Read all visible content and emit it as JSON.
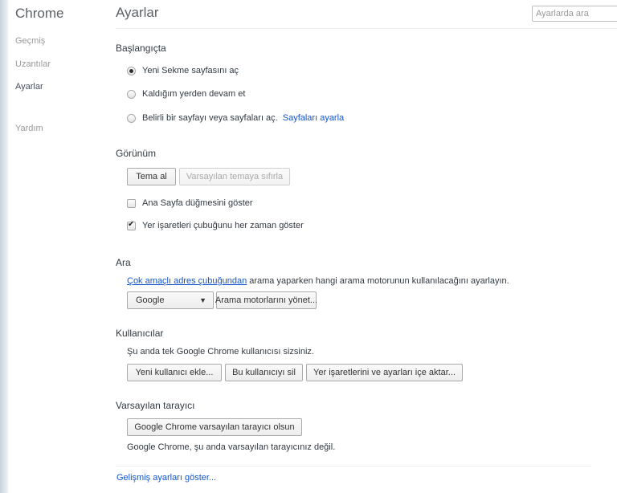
{
  "sidebar": {
    "brand": "Chrome",
    "items": [
      {
        "label": "Geçmiş"
      },
      {
        "label": "Uzantılar"
      },
      {
        "label": "Ayarlar"
      },
      {
        "label": "Yardım"
      }
    ]
  },
  "header": {
    "title": "Ayarlar",
    "search_placeholder": "Ayarlarda ara"
  },
  "startup": {
    "title": "Başlangıçta",
    "options": [
      {
        "label": "Yeni Sekme sayfasını aç",
        "checked": true
      },
      {
        "label": "Kaldığım yerden devam et",
        "checked": false
      },
      {
        "label": "Belirli bir sayfayı veya sayfaları aç.",
        "checked": false
      }
    ],
    "set_pages_link": "Sayfaları ayarla"
  },
  "appearance": {
    "title": "Görünüm",
    "theme_button": "Tema al",
    "reset_theme_button": "Varsayılan temaya sıfırla",
    "home_button_checkbox": "Ana Sayfa düğmesini göster",
    "bookmarks_bar_checkbox": "Yer işaretleri çubuğunu her zaman göster"
  },
  "search": {
    "title": "Ara",
    "omnibox_link": "Çok amaçlı adres çubuğundan",
    "description": "arama yaparken hangi arama motorunun kullanılacağını ayarlayın.",
    "engine_selected": "Google",
    "manage_button": "Arama motorlarını yönet..."
  },
  "users": {
    "title": "Kullanıcılar",
    "description": "Şu anda tek Google Chrome kullanıcısı sizsiniz.",
    "add_user_button": "Yeni kullanıcı ekle...",
    "delete_user_button": "Bu kullanıcıyı sil",
    "import_button": "Yer işaretlerini ve ayarları içe aktar..."
  },
  "default_browser": {
    "title": "Varsayılan tarayıcı",
    "make_default_button": "Google Chrome varsayılan tarayıcı olsun",
    "status": "Google Chrome, şu anda varsayılan tarayıcınız değil."
  },
  "advanced_link": "Gelişmiş ayarları göster..."
}
